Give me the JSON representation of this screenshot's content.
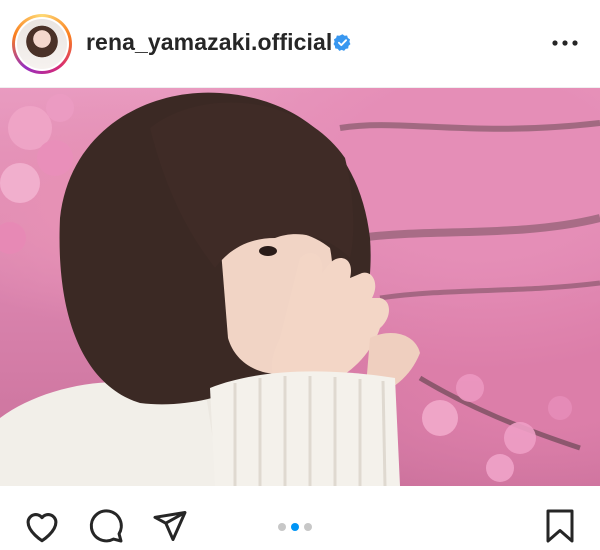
{
  "post": {
    "username": "rena_yamazaki.official",
    "verified": true
  },
  "icons": {
    "more": "more-dots-icon",
    "like": "heart-icon",
    "comment": "comment-bubble-icon",
    "share": "paper-plane-icon",
    "save": "bookmark-icon"
  },
  "carousel": {
    "count": 3,
    "active_index": 1
  },
  "colors": {
    "verified_blue": "#3897f0",
    "active_dot": "#0095f6",
    "inactive_dot": "#c7c7c7",
    "text": "#262626"
  }
}
